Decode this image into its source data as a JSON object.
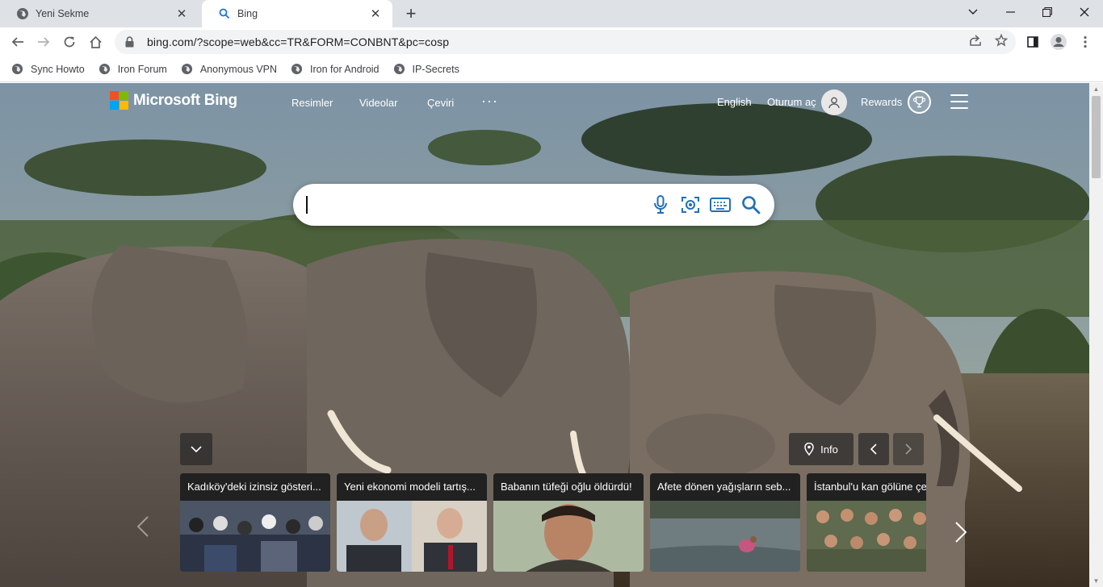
{
  "tabs": [
    {
      "title": "Yeni Sekme",
      "icon": "globe-icon",
      "close": "✕"
    },
    {
      "title": "Bing",
      "icon": "search-icon",
      "close": "✕"
    }
  ],
  "new_tab_label": "+",
  "window_controls": [
    "chevron-down-icon",
    "minimize-icon",
    "restore-icon",
    "close-icon"
  ],
  "toolbar": {
    "url": "bing.com/?scope=web&cc=TR&FORM=CONBNT&pc=cosp"
  },
  "bookmarks": [
    {
      "label": "Sync Howto"
    },
    {
      "label": "Iron Forum"
    },
    {
      "label": "Anonymous VPN"
    },
    {
      "label": "Iron for Android"
    },
    {
      "label": "IP-Secrets"
    }
  ],
  "bing": {
    "logo_text": "Microsoft Bing",
    "logo_colors": [
      "#f25022",
      "#7fba00",
      "#00a4ef",
      "#ffb900"
    ],
    "nav": [
      "Resimler",
      "Videolar",
      "Çeviri"
    ],
    "nav_more": "···",
    "language": "English",
    "sign_in": "Oturum aç",
    "rewards": "Rewards",
    "accent": "#1f70b8",
    "info_label": "Info"
  },
  "news": [
    {
      "title": "Kadıköy'deki izinsiz gösteri..."
    },
    {
      "title": "Yeni ekonomi modeli tartış..."
    },
    {
      "title": "Babanın tüfeği oğlu öldürdü!"
    },
    {
      "title": "Afete dönen yağışların seb..."
    },
    {
      "title": "İstanbul'u kan gölüne çe"
    }
  ]
}
